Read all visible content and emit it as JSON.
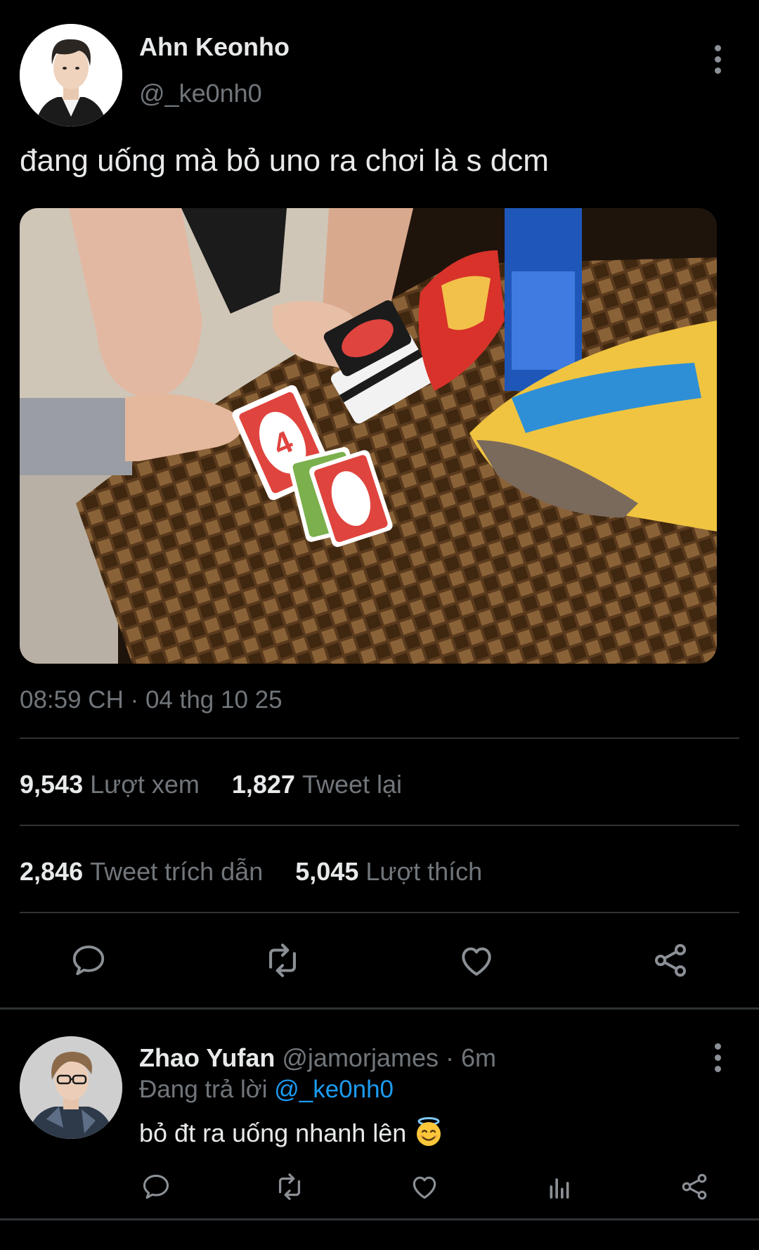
{
  "post": {
    "author_name": "Ahn Keonho",
    "author_handle": "@_ke0nh0",
    "text": "đang uống mà bỏ uno ra chơi là s dcm",
    "timestamp": "08:59 CH · 04 thg 10 25",
    "stats": {
      "views_count": "9,543",
      "views_label": "Lượt xem",
      "retweets_count": "1,827",
      "retweets_label": "Tweet lại",
      "quotes_count": "2,846",
      "quotes_label": "Tweet trích dẫn",
      "likes_count": "5,045",
      "likes_label": "Lượt thích"
    },
    "actions": [
      "comment-icon",
      "retweet-icon",
      "heart-icon",
      "share-icon"
    ]
  },
  "reply": {
    "author_name": "Zhao Yufan",
    "author_handle": "@jamorjames",
    "time": "· 6m",
    "replying_prefix": "Đang trả lời",
    "replying_to": "@_ke0nh0",
    "text": "bỏ đt ra uống nhanh lên",
    "emoji": "smiling-face-with-halo",
    "actions": [
      "comment-icon",
      "retweet-icon",
      "heart-icon",
      "analytics-icon",
      "share-icon"
    ]
  },
  "colors": {
    "background": "#000000",
    "text_primary": "#e7e9ea",
    "text_secondary": "#71767b",
    "link": "#1d9bf0",
    "divider": "#2f3336"
  }
}
